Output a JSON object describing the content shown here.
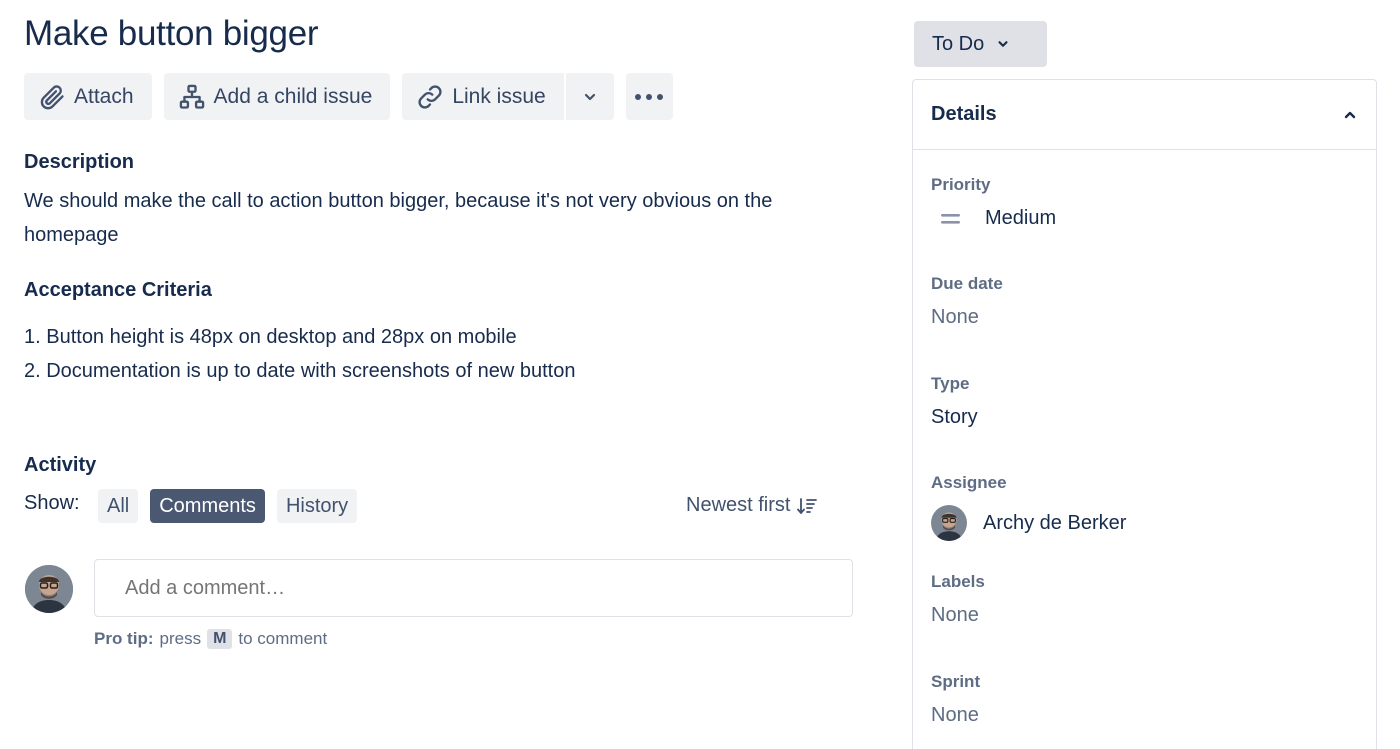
{
  "issue": {
    "title": "Make button bigger"
  },
  "toolbar": {
    "attach_label": "Attach",
    "child_label": "Add a child issue",
    "link_label": "Link issue"
  },
  "description": {
    "heading": "Description",
    "text": "We should make the call to action button bigger, because it's not very obvious on the homepage"
  },
  "acceptance": {
    "heading": "Acceptance Criteria",
    "items": [
      "1. Button height is 48px on desktop and 28px on mobile",
      "2. Documentation is up to date with screenshots of new button"
    ]
  },
  "activity": {
    "heading": "Activity",
    "show_label": "Show:",
    "filters": [
      "All",
      "Comments",
      "History"
    ],
    "active_filter": "Comments",
    "sort_label": "Newest first"
  },
  "comment": {
    "placeholder": "Add a comment…",
    "protip_label": "Pro tip:",
    "protip_pre": "press",
    "protip_key": "M",
    "protip_post": "to comment"
  },
  "status": {
    "label": "To Do"
  },
  "details": {
    "heading": "Details",
    "fields": [
      {
        "label": "Priority",
        "value": "Medium"
      },
      {
        "label": "Due date",
        "value": "None"
      },
      {
        "label": "Type",
        "value": "Story"
      },
      {
        "label": "Assignee",
        "value": "Archy de Berker"
      },
      {
        "label": "Labels",
        "value": "None"
      },
      {
        "label": "Sprint",
        "value": "None"
      }
    ]
  },
  "icons": [
    "paperclip-icon",
    "hierarchy-icon",
    "link-icon",
    "chevron-down-icon",
    "more-icon",
    "sort-icon",
    "priority-medium-icon",
    "chevron-up-icon"
  ],
  "colors": {
    "active_filter": "#4A5872",
    "text": "#172B4D",
    "muted": "#5E6C84",
    "button_bg": "#F1F2F4"
  }
}
